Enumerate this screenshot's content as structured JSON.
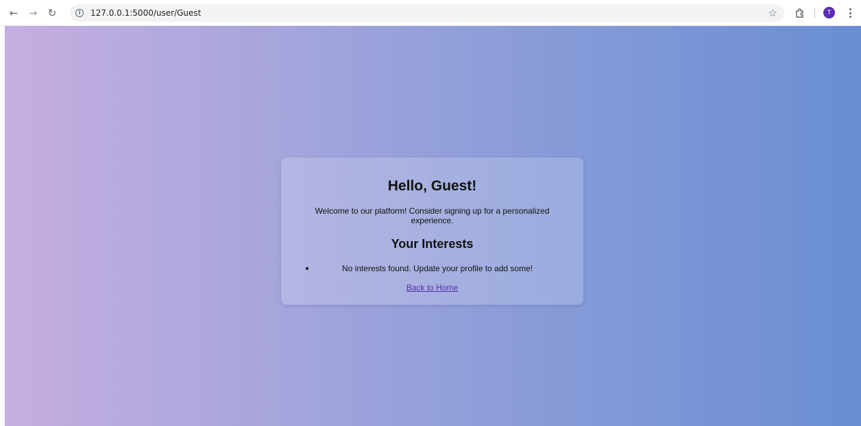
{
  "browser": {
    "url": "127.0.0.1:5000/user/Guest",
    "avatar_letter": "T",
    "icons": {
      "back": "arrow-left-icon",
      "forward": "arrow-right-icon",
      "reload": "reload-icon",
      "info": "info-icon",
      "bookmark": "star-icon",
      "extensions": "puzzle-icon",
      "menu": "kebab-menu-icon"
    }
  },
  "card": {
    "greeting": "Hello, Guest!",
    "welcome_message": "Welcome to our platform! Consider signing up for a personalized experience.",
    "interests_heading": "Your Interests",
    "interests": [
      "No interests found. Update your profile to add some!"
    ],
    "back_link": "Back to Home"
  },
  "colors": {
    "gradient_start": "#c6aee0",
    "gradient_end": "#6a8ed3",
    "link": "#5a2bb0",
    "avatar": "#5b2bb5"
  }
}
